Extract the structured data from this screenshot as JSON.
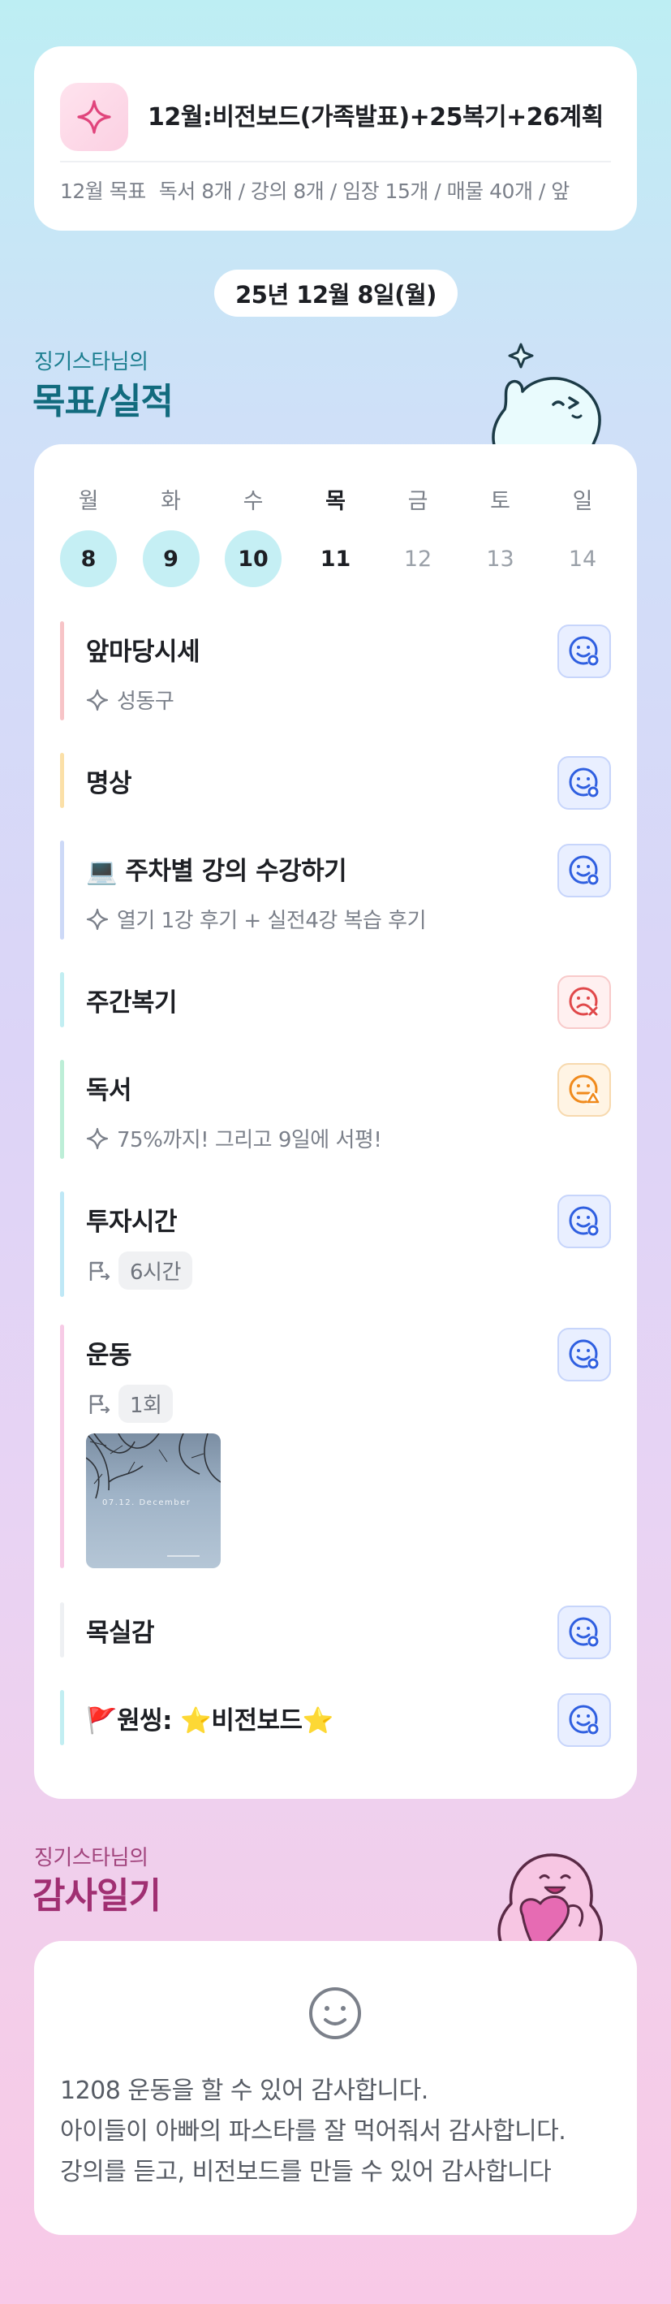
{
  "header": {
    "title": "12월:비전보드(가족발표)+25복기+26계획",
    "subtitle_label": "12월 목표",
    "subtitle_text": "독서 8개 / 강의 8개 / 임장 15개 / 매물 40개 / 앞"
  },
  "date": "25년 12월 8일(월)",
  "goals_section": {
    "user": "징기스타님의",
    "title": "목표/실적"
  },
  "week": {
    "days": [
      "월",
      "화",
      "수",
      "목",
      "금",
      "토",
      "일"
    ],
    "dates": [
      "8",
      "9",
      "10",
      "11",
      "12",
      "13",
      "14"
    ]
  },
  "goals": [
    {
      "name": "앞마당시세",
      "note": "성동구",
      "status": "ok",
      "color": "#f7c4c7"
    },
    {
      "name": "명상",
      "status": "ok",
      "color": "#fbe0a8"
    },
    {
      "name": "💻 주차별 강의 수강하기",
      "note": "열기 1강 후기 + 실전4강 복습 후기",
      "status": "ok",
      "color": "#cdd9f7"
    },
    {
      "name": "주간복기",
      "status": "bad",
      "color": "#c2eef2"
    },
    {
      "name": "독서",
      "note": "75%까지! 그리고 9일에 서평!",
      "status": "warn",
      "color": "#bdeed7"
    },
    {
      "name": "투자시간",
      "chip": "6시간",
      "status": "ok",
      "color": "#bfe8f6"
    },
    {
      "name": "운동",
      "chip": "1회",
      "photo_caption": "07.12. December",
      "status": "ok",
      "color": "#f7cbe6"
    },
    {
      "name": "목실감",
      "status": "ok",
      "color": "#eef0f3"
    },
    {
      "name": "🚩원씽: ⭐비전보드⭐",
      "status": "ok",
      "color": "#c2eef2"
    }
  ],
  "diary_section": {
    "user": "징기스타님의",
    "title": "감사일기"
  },
  "diary": {
    "lines": [
      "1208 운동을 할 수 있어 감사합니다.",
      "아이들이 아빠의 파스타를 잘 먹어줘서 감사합니다.",
      "강의를 듣고, 비전보드를 만들 수 있어 감사합니다"
    ]
  },
  "colors": {
    "ok": "#2f5fe0",
    "bad": "#e0484a",
    "warn": "#f08a1c",
    "goals_heading": "#126b7e",
    "diary_heading": "#a02f72"
  }
}
